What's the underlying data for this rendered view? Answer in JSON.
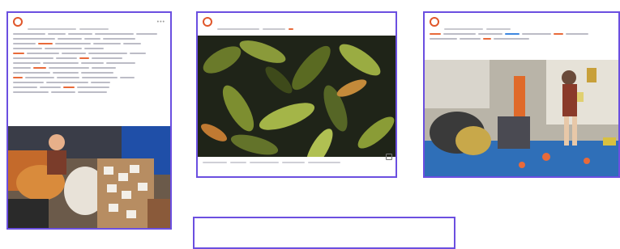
{
  "colors": {
    "border": "#6b4fe0",
    "accent": "#e86a3a",
    "link": "#3d87e0"
  },
  "cards": [
    {
      "name": "",
      "photo_icon": "workshop-crafts-photo"
    },
    {
      "name": "",
      "photo_icon": "leaf-texture-photo"
    },
    {
      "name": "",
      "photo_icon": "classroom-photo"
    },
    {
      "name": ""
    }
  ]
}
